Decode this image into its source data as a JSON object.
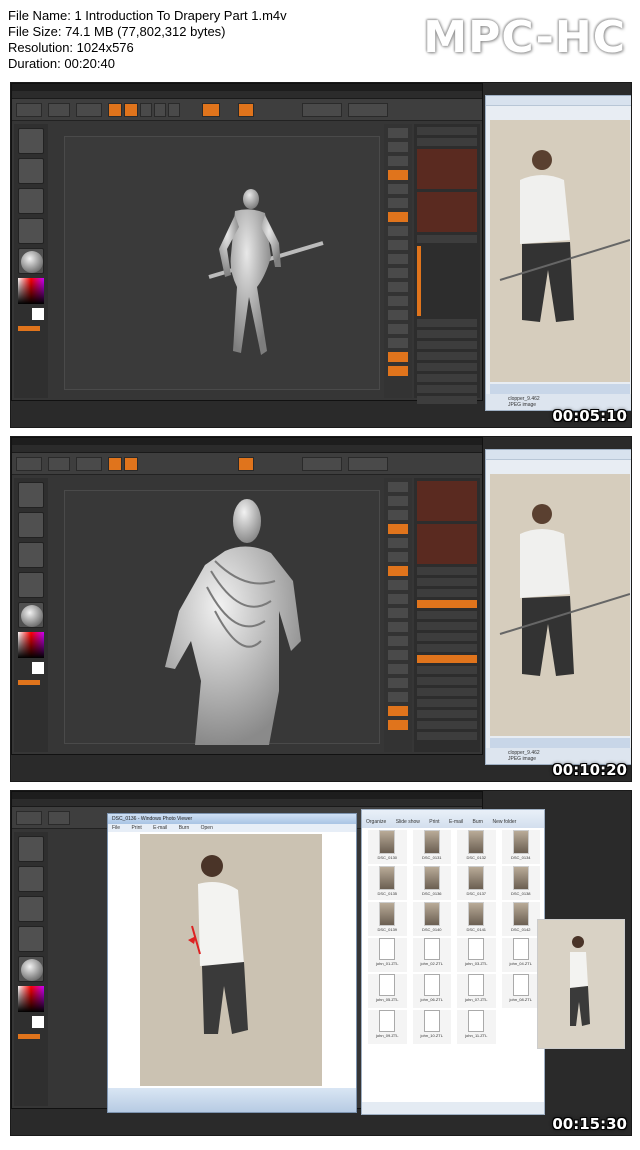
{
  "info": {
    "file_name": "File Name: 1 Introduction To Drapery Part 1.m4v",
    "file_size": "File Size: 74.1 MB (77,802,312 bytes)",
    "resolution": "Resolution: 1024x576",
    "duration": "Duration: 00:20:40"
  },
  "brand": "MPC-HC",
  "frames": [
    {
      "timestamp": "00:05:10",
      "status_file": "clopper_9.462",
      "status_type": "JPEG image"
    },
    {
      "timestamp": "00:10:20",
      "status_file": "clopper_9.462",
      "status_type": "JPEG image"
    },
    {
      "timestamp": "00:15:30"
    }
  ],
  "viewer": {
    "title": "DSC_0136 - Windows Photo Viewer",
    "menu": [
      "File",
      "Print",
      "E-mail",
      "Burn",
      "Open"
    ]
  },
  "explorer": {
    "toolbar": [
      "Organize",
      "Slide show",
      "Print",
      "E-mail",
      "Burn",
      "New folder"
    ],
    "files": [
      "DSC_0130",
      "DSC_0131",
      "DSC_0132",
      "DSC_0134",
      "DSC_0135",
      "DSC_0136",
      "DSC_0137",
      "DSC_0138",
      "DSC_0139",
      "DSC_0140",
      "DSC_0141",
      "DSC_0142",
      "john_01.ZTL",
      "john_02.ZTL",
      "john_03.ZTL",
      "john_04.ZTL",
      "john_05.ZTL",
      "john_06.ZTL",
      "john_07.ZTL",
      "john_08.ZTL",
      "john_09.ZTL",
      "john_10.ZTL",
      "john_11.ZTL"
    ],
    "file_kinds": [
      "photo",
      "photo",
      "photo",
      "photo",
      "photo",
      "photo",
      "photo",
      "photo",
      "photo",
      "photo",
      "photo",
      "photo",
      "doc",
      "doc",
      "doc",
      "doc",
      "doc",
      "doc",
      "doc",
      "doc",
      "doc",
      "doc",
      "doc"
    ]
  },
  "colors": {
    "accent": "#e0741c",
    "ui_dark": "#363636"
  }
}
